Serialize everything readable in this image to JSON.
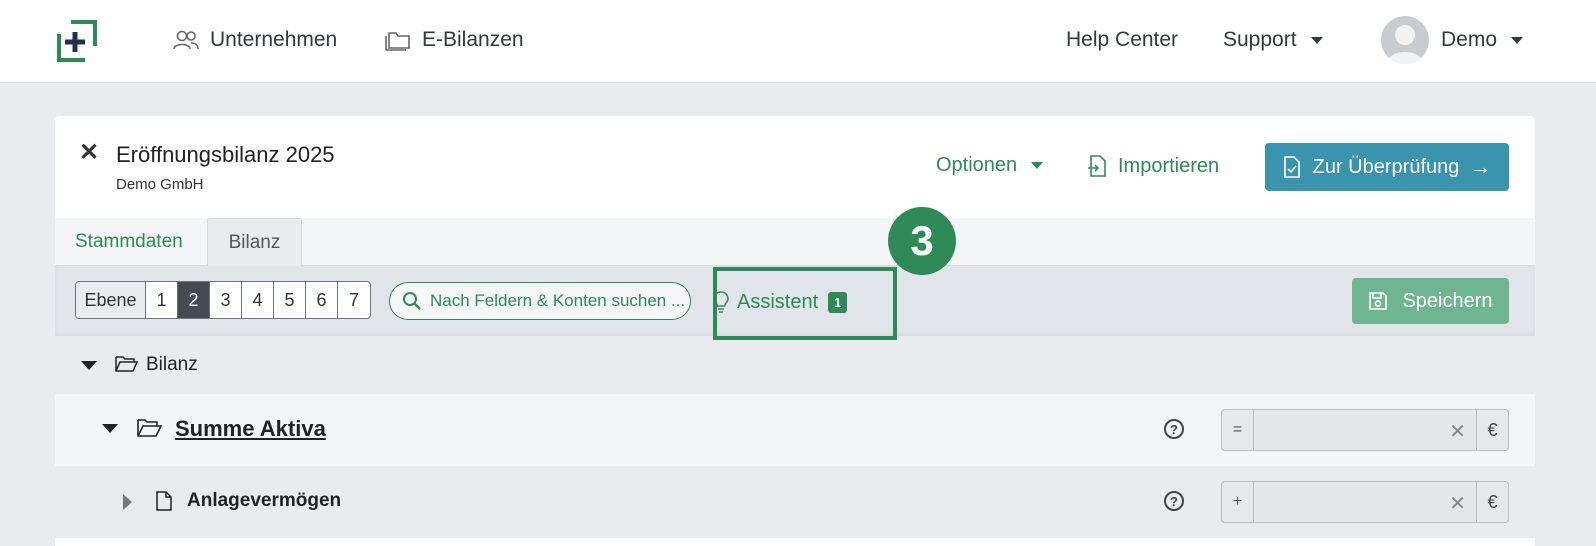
{
  "nav": {
    "unternehmen": "Unternehmen",
    "ebilanzen": "E-Bilanzen",
    "help": "Help Center",
    "support": "Support",
    "user": "Demo"
  },
  "doc": {
    "title": "Eröffnungsbilanz 2025",
    "company": "Demo GmbH"
  },
  "actions": {
    "options": "Optionen",
    "import": "Importieren",
    "review": "Zur Überprüfung"
  },
  "tabs": [
    {
      "label": "Stammdaten",
      "active": false
    },
    {
      "label": "Bilanz",
      "active": true
    }
  ],
  "toolbar": {
    "level_label": "Ebene",
    "levels": [
      "1",
      "2",
      "3",
      "4",
      "5",
      "6",
      "7"
    ],
    "active_level": "2",
    "search_placeholder": "Nach Feldern & Konten suchen ...",
    "assistant": "Assistent",
    "assistant_count": "1",
    "save": "Speichern"
  },
  "step": "3",
  "tree": {
    "root": "Bilanz",
    "aktiva": {
      "label": "Summe Aktiva",
      "prefix": "=",
      "value": "",
      "currency": "€"
    },
    "anlage": {
      "label": "Anlagevermögen",
      "prefix": "+",
      "value": "",
      "currency": "€"
    }
  },
  "colors": {
    "accent_green": "#2e8b57",
    "review_blue": "#3a94ad",
    "save_green": "#6fb591"
  }
}
